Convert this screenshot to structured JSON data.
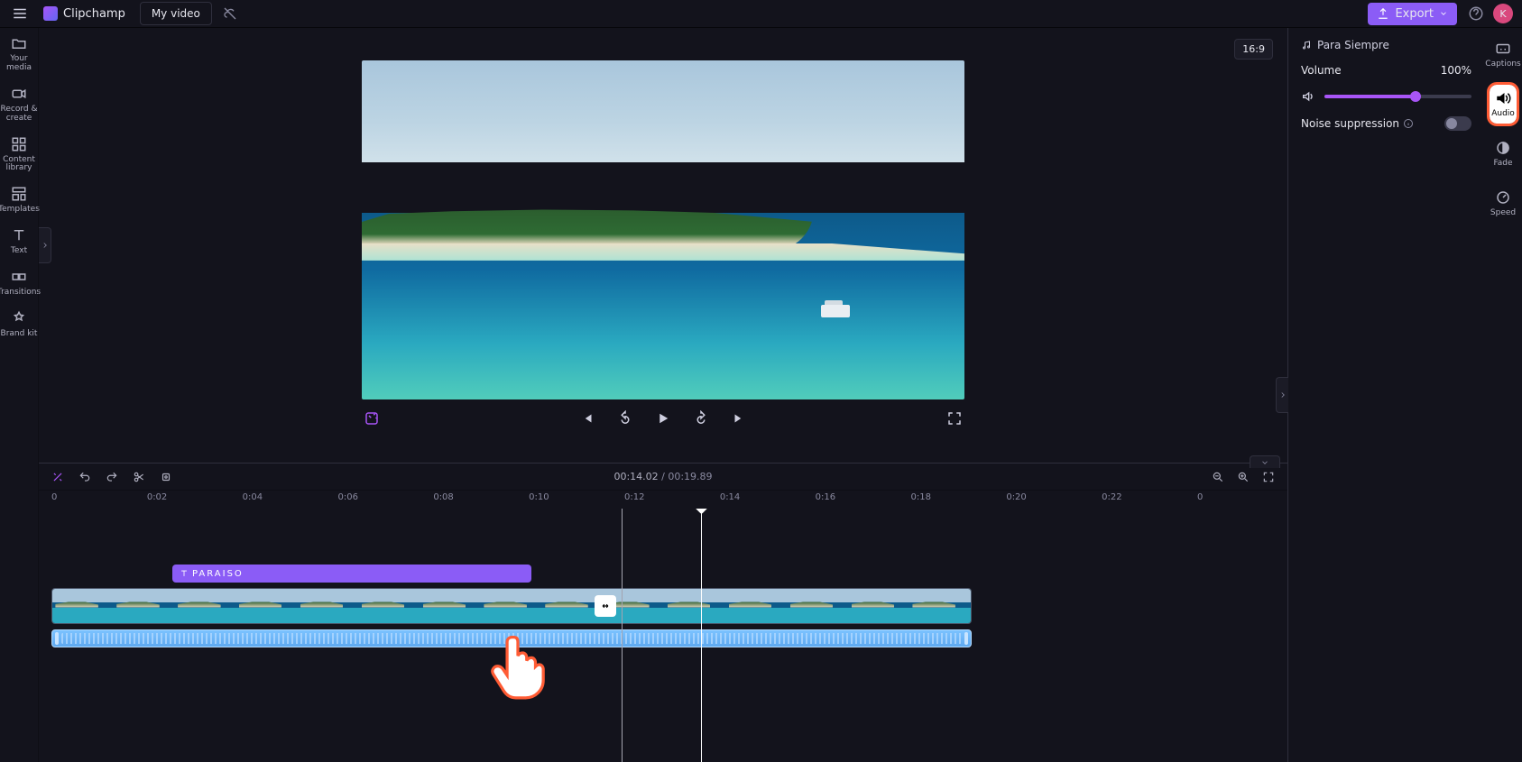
{
  "header": {
    "brand": "Clipchamp",
    "tab_title": "My video",
    "export_label": "Export",
    "avatar_initial": "K"
  },
  "left_nav": {
    "your_media": "Your media",
    "record_create": "Record & create",
    "content_library": "Content library",
    "templates": "Templates",
    "text": "Text",
    "transitions": "Transitions",
    "brand_kit": "Brand kit"
  },
  "preview": {
    "aspect_ratio": "16:9"
  },
  "timeline": {
    "current_time": "00:14.02",
    "duration": "00:19.89",
    "ruler": [
      "0",
      "0:02",
      "0:04",
      "0:06",
      "0:08",
      "0:10",
      "0:12",
      "0:14",
      "0:16",
      "0:18",
      "0:20",
      "0:22",
      "0"
    ],
    "text_clip_label": "PARAISO"
  },
  "right_panel": {
    "track_name": "Para Siempre",
    "volume_label": "Volume",
    "volume_value": "100%",
    "noise_label": "Noise suppression"
  },
  "right_nav": {
    "captions": "Captions",
    "audio": "Audio",
    "fade": "Fade",
    "speed": "Speed"
  }
}
